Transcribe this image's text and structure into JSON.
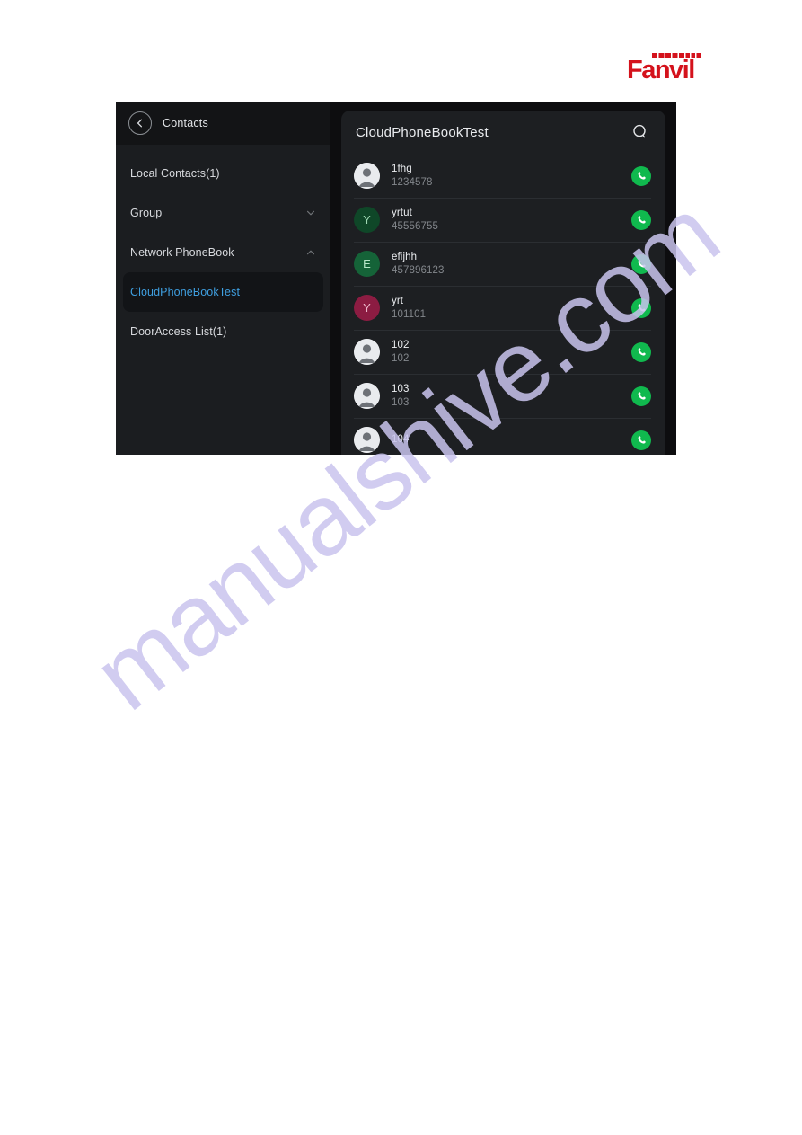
{
  "brand": {
    "logo_text": "Fanvil",
    "logo_color": "#d4121c"
  },
  "watermark": {
    "text": "manualshive.com",
    "color": "#c9c4ee"
  },
  "left_panel": {
    "back_icon": "chevron-left-icon",
    "title": "Contacts",
    "items": [
      {
        "label": "Local Contacts(1)",
        "chevron": "",
        "selected": false
      },
      {
        "label": "Group",
        "chevron": "chevron-down-icon",
        "selected": false
      },
      {
        "label": "Network PhoneBook",
        "chevron": "chevron-up-icon",
        "selected": false
      },
      {
        "label": "CloudPhoneBookTest",
        "chevron": "",
        "selected": true
      },
      {
        "label": "DoorAccess List(1)",
        "chevron": "",
        "selected": false
      }
    ],
    "selected_color": "#3f9fe0"
  },
  "right_panel": {
    "title": "CloudPhoneBookTest",
    "search_icon": "search-icon",
    "call_icon": "phone-call-icon",
    "call_button_color": "#10b94e",
    "contacts": [
      {
        "name": "1fhg",
        "number": "1234578",
        "avatar_type": "photo",
        "initial": "",
        "avatar_color": "#e9ebee"
      },
      {
        "name": "yrtut",
        "number": "45556755",
        "avatar_type": "initial",
        "initial": "Y",
        "avatar_color": "#0f4728"
      },
      {
        "name": "efijhh",
        "number": "457896123",
        "avatar_type": "initial",
        "initial": "E",
        "avatar_color": "#156338"
      },
      {
        "name": "yrt",
        "number": "101101",
        "avatar_type": "initial",
        "initial": "Y",
        "avatar_color": "#8c1c42"
      },
      {
        "name": "102",
        "number": "102",
        "avatar_type": "photo",
        "initial": "",
        "avatar_color": "#e9ebee"
      },
      {
        "name": "103",
        "number": "103",
        "avatar_type": "photo",
        "initial": "",
        "avatar_color": "#e9ebee"
      },
      {
        "name": "104",
        "number": "",
        "avatar_type": "photo",
        "initial": "",
        "avatar_color": "#e9ebee"
      }
    ]
  }
}
